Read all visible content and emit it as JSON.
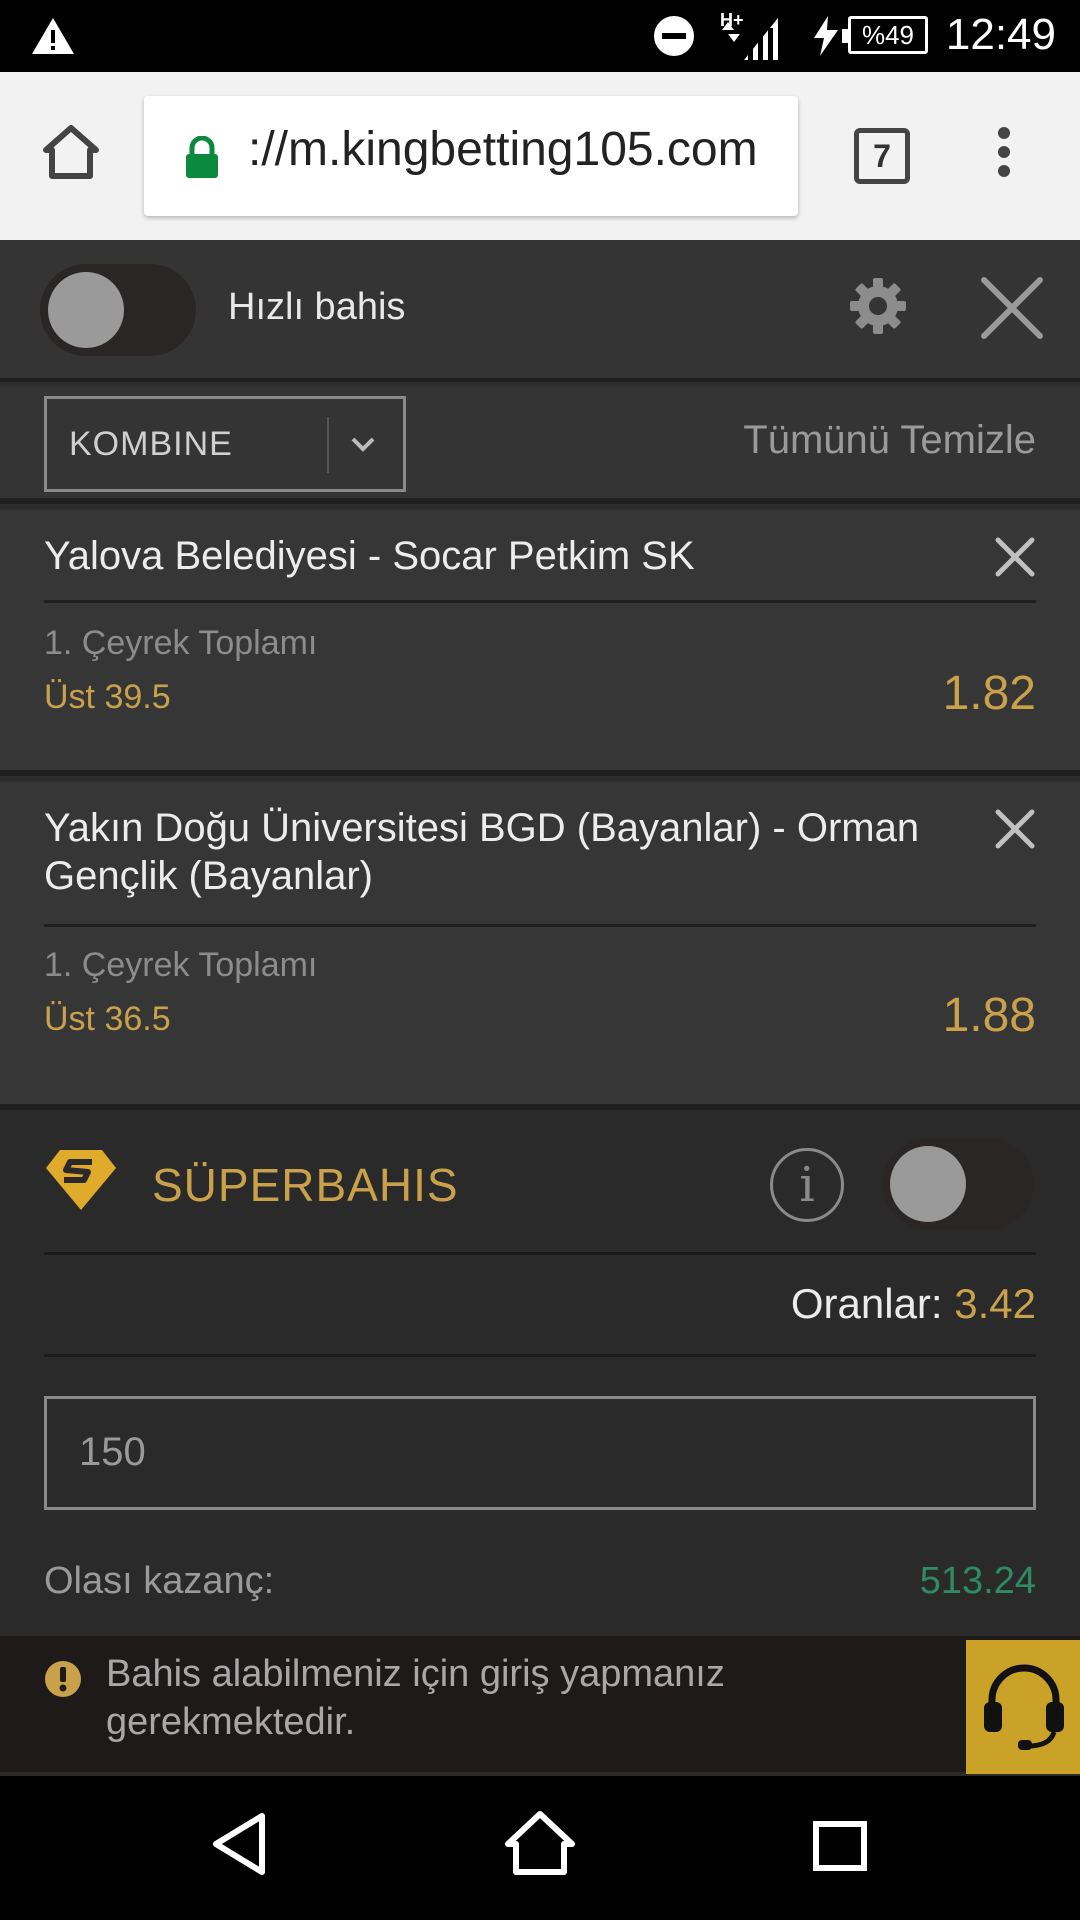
{
  "status_bar": {
    "time": "12:49",
    "battery": "%49",
    "network": "H+",
    "icons": [
      "warning-icon",
      "do-not-disturb-icon",
      "signal-icon",
      "charging-icon",
      "battery-icon"
    ]
  },
  "browser": {
    "url": "://m.kingbetting105.com",
    "tab_count": "7",
    "icons": [
      "home-icon",
      "lock-icon",
      "tabs-icon",
      "more-vert-icon"
    ]
  },
  "betslip": {
    "quick_bet_label": "Hızlı bahis",
    "bet_type": "KOMBINE",
    "clear_all": "Tümünü Temizle",
    "bets": [
      {
        "teams": "Yalova Belediyesi - Socar Petkim SK",
        "market": "1. Çeyrek Toplamı",
        "selection": "Üst 39.5",
        "odds": "1.82"
      },
      {
        "teams": "Yakın Doğu Üniversitesi BGD (Bayanlar) - Orman Gençlik (Bayanlar)",
        "market": "1. Çeyrek Toplamı",
        "selection": "Üst 36.5",
        "odds": "1.88"
      }
    ],
    "super_label": "SÜPERBAHIS",
    "odds_label": "Oranlar:",
    "total_odds": "3.42",
    "stake_value": "150",
    "win_label": "Olası kazanç:",
    "win_value": "513.24",
    "login_alert": "Bahis alabilmeniz için giriş yapmanız gerekmektedir."
  },
  "colors": {
    "accent_gold": "#c9a14a",
    "win_green": "#2e8b63",
    "support_bg": "#c9a227"
  }
}
